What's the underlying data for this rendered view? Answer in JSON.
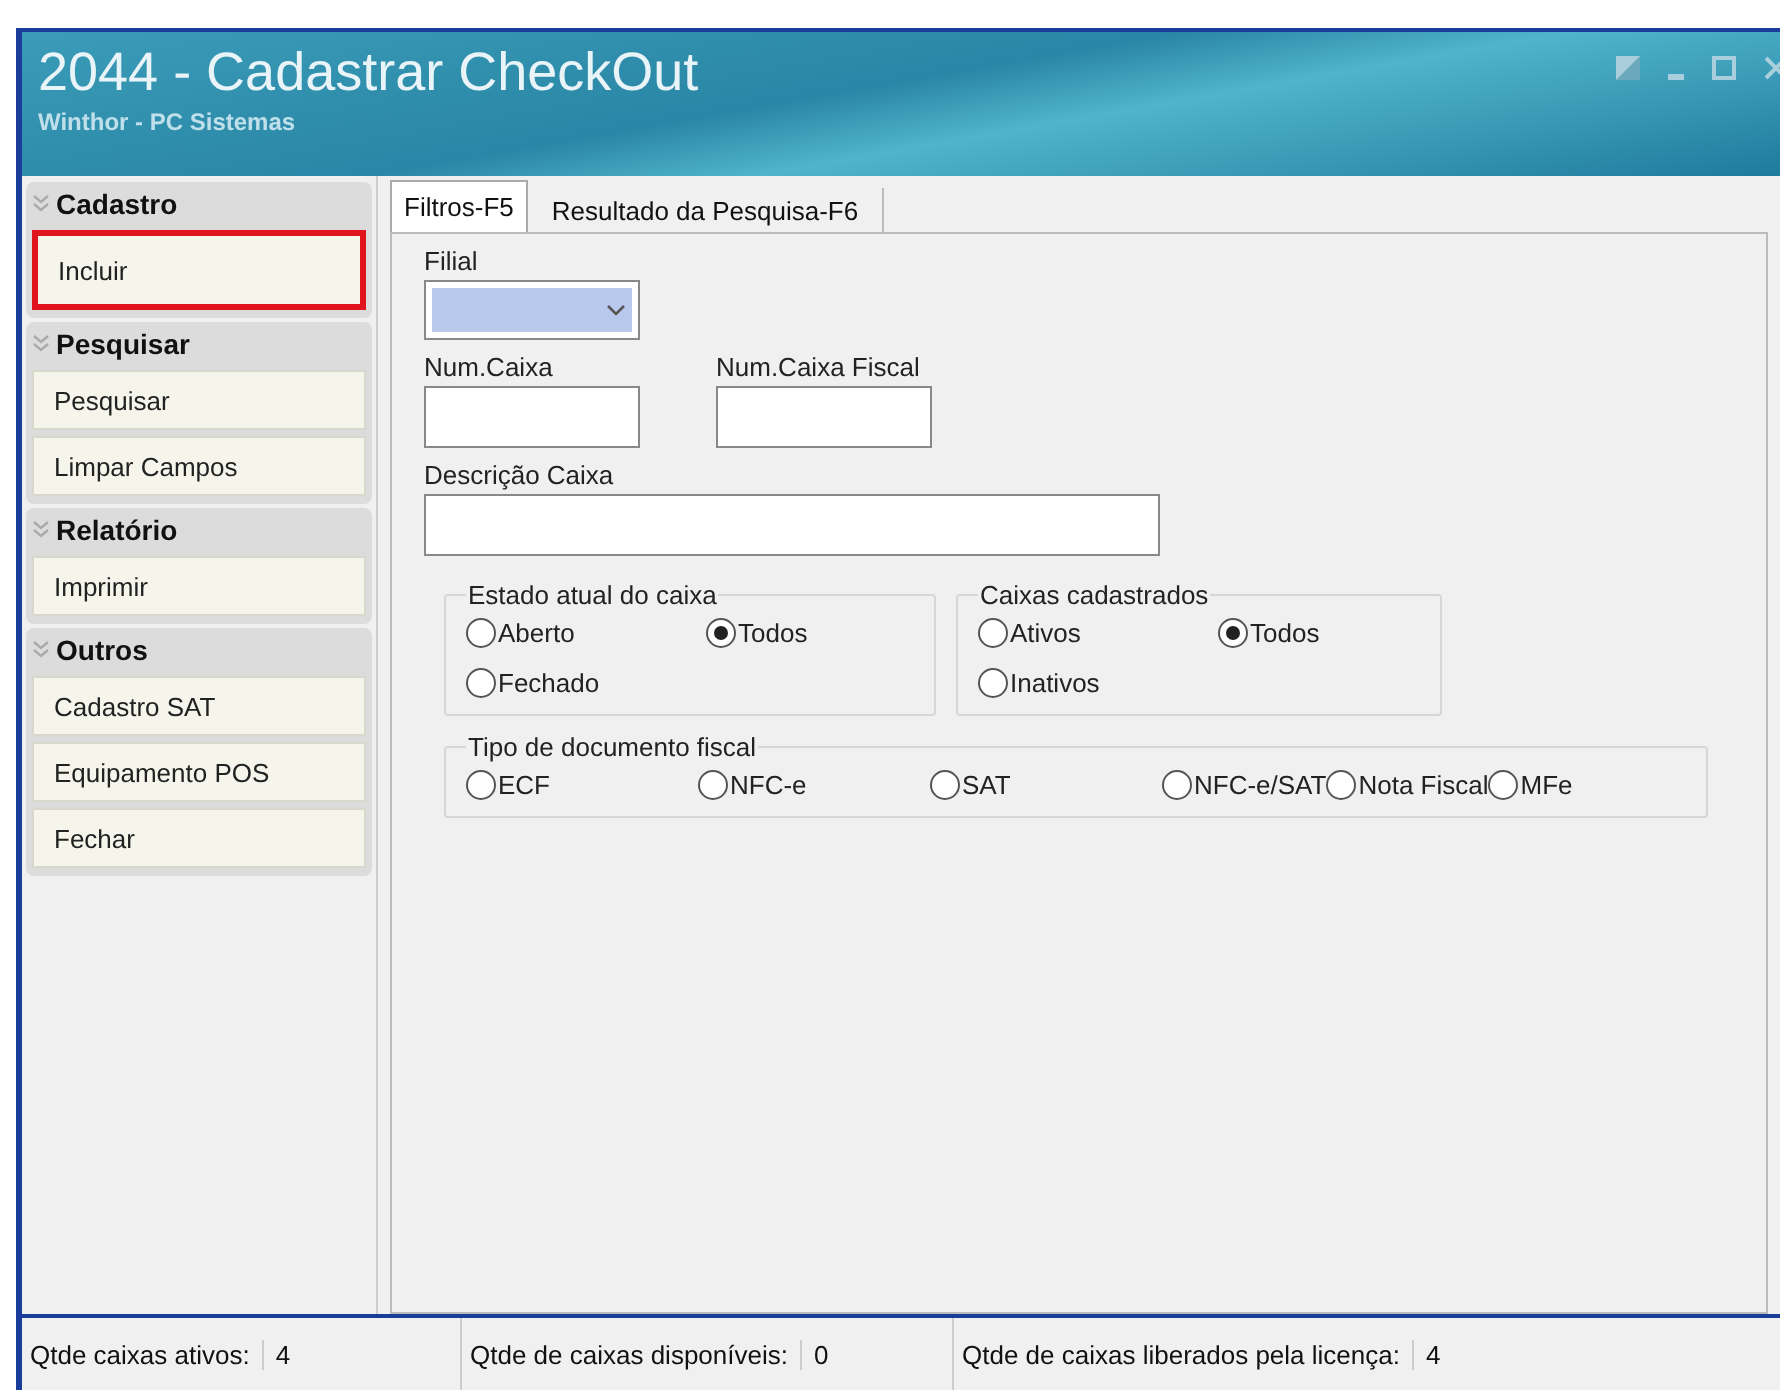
{
  "window": {
    "title": "2044 - Cadastrar CheckOut",
    "subtitle": "Winthor - PC Sistemas"
  },
  "sidebar": {
    "groups": [
      {
        "label": "Cadastro",
        "items": [
          {
            "label": "Incluir",
            "highlighted": true
          }
        ]
      },
      {
        "label": "Pesquisar",
        "items": [
          {
            "label": "Pesquisar",
            "highlighted": false
          },
          {
            "label": "Limpar Campos",
            "highlighted": false
          }
        ]
      },
      {
        "label": "Relatório",
        "items": [
          {
            "label": "Imprimir",
            "highlighted": false
          }
        ]
      },
      {
        "label": "Outros",
        "items": [
          {
            "label": "Cadastro SAT",
            "highlighted": false
          },
          {
            "label": "Equipamento POS",
            "highlighted": false
          },
          {
            "label": "Fechar",
            "highlighted": false
          }
        ]
      }
    ]
  },
  "tabs": [
    {
      "label": "Filtros-F5",
      "selected": true
    },
    {
      "label": "Resultado da Pesquisa-F6",
      "selected": false
    }
  ],
  "filters": {
    "filial": {
      "label": "Filial"
    },
    "num_caixa": {
      "label": "Num.Caixa"
    },
    "num_caixa_fiscal": {
      "label": "Num.Caixa Fiscal"
    },
    "descricao": {
      "label": "Descrição Caixa"
    }
  },
  "option_groups": [
    {
      "title": "Estado atual do caixa",
      "kind": "grid",
      "options": [
        {
          "label": "Aberto",
          "selected": false
        },
        {
          "label": "Todos",
          "selected": true
        },
        {
          "label": "Fechado",
          "selected": false
        }
      ]
    },
    {
      "title": "Caixas cadastrados",
      "kind": "grid",
      "options": [
        {
          "label": "Ativos",
          "selected": false
        },
        {
          "label": "Todos",
          "selected": true
        },
        {
          "label": "Inativos",
          "selected": false
        }
      ]
    },
    {
      "title": "Tipo de documento fiscal",
      "kind": "row",
      "options": [
        {
          "label": "ECF",
          "selected": false
        },
        {
          "label": "NFC-e",
          "selected": false
        },
        {
          "label": "SAT",
          "selected": false
        },
        {
          "label": "NFC-e/SAT",
          "selected": false
        },
        {
          "label": "Nota Fiscal",
          "selected": false
        },
        {
          "label": "MFe",
          "selected": false
        }
      ]
    }
  ],
  "status_bar": [
    {
      "label": "Qtde caixas ativos:",
      "value": "4"
    },
    {
      "label": "Qtde de caixas disponíveis:",
      "value": "0"
    },
    {
      "label": "Qtde de caixas liberados pela licença:",
      "value": "4"
    }
  ]
}
